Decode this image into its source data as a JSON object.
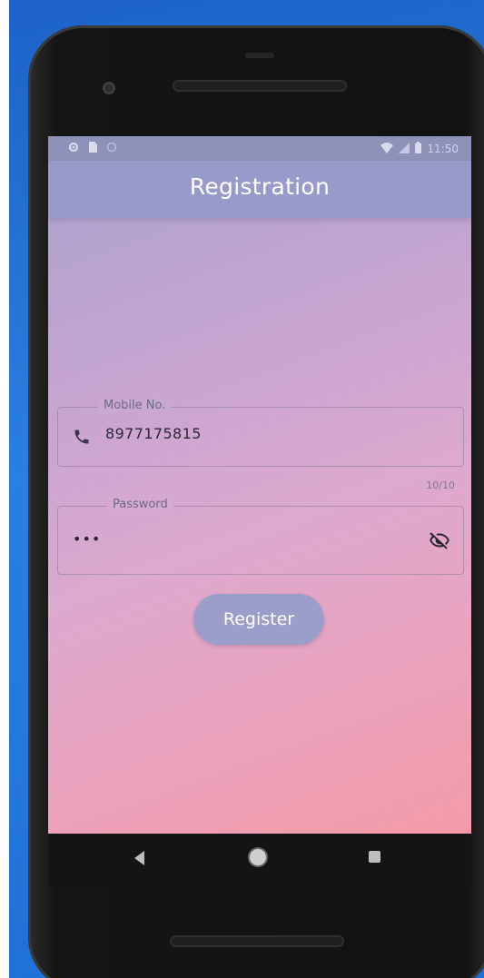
{
  "status_bar": {
    "time": "11:50",
    "left_icons": [
      "settings-icon",
      "sim-card-icon",
      "circle-icon"
    ],
    "right_icons": [
      "wifi-icon",
      "signal-icon",
      "battery-icon"
    ]
  },
  "app_bar": {
    "title": "Registration",
    "background": "#969bc9"
  },
  "form": {
    "mobile": {
      "label": "Mobile No.",
      "value": "8977175815",
      "counter": "10/10",
      "icon": "phone-icon"
    },
    "password": {
      "label": "Password",
      "value": "•••",
      "icon": "visibility-off-icon"
    },
    "register_label": "Register"
  },
  "nav_bar": {
    "buttons": [
      "back-icon",
      "home-icon",
      "recent-apps-icon"
    ]
  },
  "colors": {
    "gradient_start": "#a8a3cc",
    "gradient_end": "#f39aa8",
    "button": "#9a9ec9"
  }
}
